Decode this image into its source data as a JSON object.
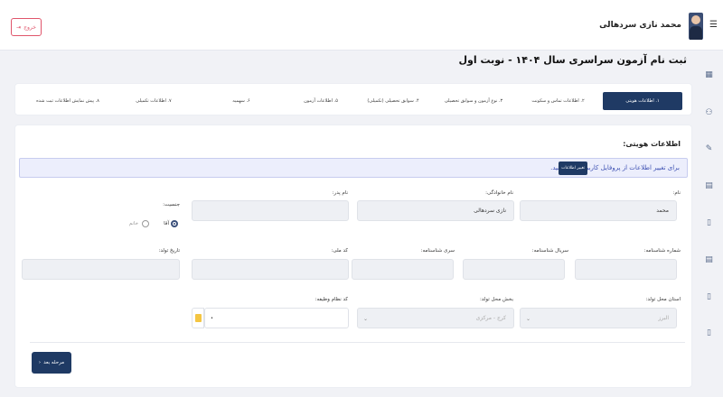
{
  "header": {
    "user_name": "محمد نازی سردهالی",
    "logout_label": "خروج",
    "menu_icon": "hamburger-icon",
    "logout_icon": "logout-icon"
  },
  "page": {
    "title": "ثبت نام آزمون سراسری سال ۱۴۰۴ - نوبت اول"
  },
  "steps": [
    {
      "label": "۱. اطلاعات هویتی",
      "active": true
    },
    {
      "label": "۲. اطلاعات تماس و سکونت",
      "active": false
    },
    {
      "label": "۳. نوع آزمون و سوابق تحصیلی",
      "active": false
    },
    {
      "label": "۴. سوابق تحصیلی (تکمیلی)",
      "active": false
    },
    {
      "label": "۵. اطلاعات آزمون",
      "active": false
    },
    {
      "label": "۶. سهمیه",
      "active": false
    },
    {
      "label": "۷. اطلاعات تکمیلی",
      "active": false
    },
    {
      "label": "۸. پیش نمایش اطلاعات ثبت شده",
      "active": false
    }
  ],
  "section": {
    "title": "اطلاعات هویتی:",
    "info_text": "برای تغییر اطلاعات از پروفایل کاربری اقدام کنید.",
    "info_button": "تغییر اطلاعات"
  },
  "form": {
    "first_name": {
      "label": "نام:",
      "value": "محمد"
    },
    "last_name": {
      "label": "نام خانوادگی:",
      "value": "نازی سردهالی"
    },
    "father_name": {
      "label": "نام پدر:",
      "value": ""
    },
    "gender": {
      "label": "جنسیت:",
      "options": [
        "آقا",
        "خانم"
      ],
      "selected": "آقا"
    },
    "id_number": {
      "label": "شماره شناسنامه:",
      "value": ""
    },
    "id_serial": {
      "label": "سریال شناسنامه:",
      "value": ""
    },
    "id_series": {
      "label": "سری شناسنامه:",
      "value": ""
    },
    "national_code": {
      "label": "کد ملی:",
      "value": ""
    },
    "birth_date": {
      "label": "تاریخ تولد:",
      "value": ""
    },
    "birth_province": {
      "label": "استان محل تولد:",
      "value": "البرز"
    },
    "birth_district": {
      "label": "بخش محل تولد:",
      "value": "کرج - مرکزی"
    },
    "military_code": {
      "label": "کد نظام وظیفه:",
      "value": "•"
    }
  },
  "actions": {
    "next_label": "مرحله بعد"
  }
}
